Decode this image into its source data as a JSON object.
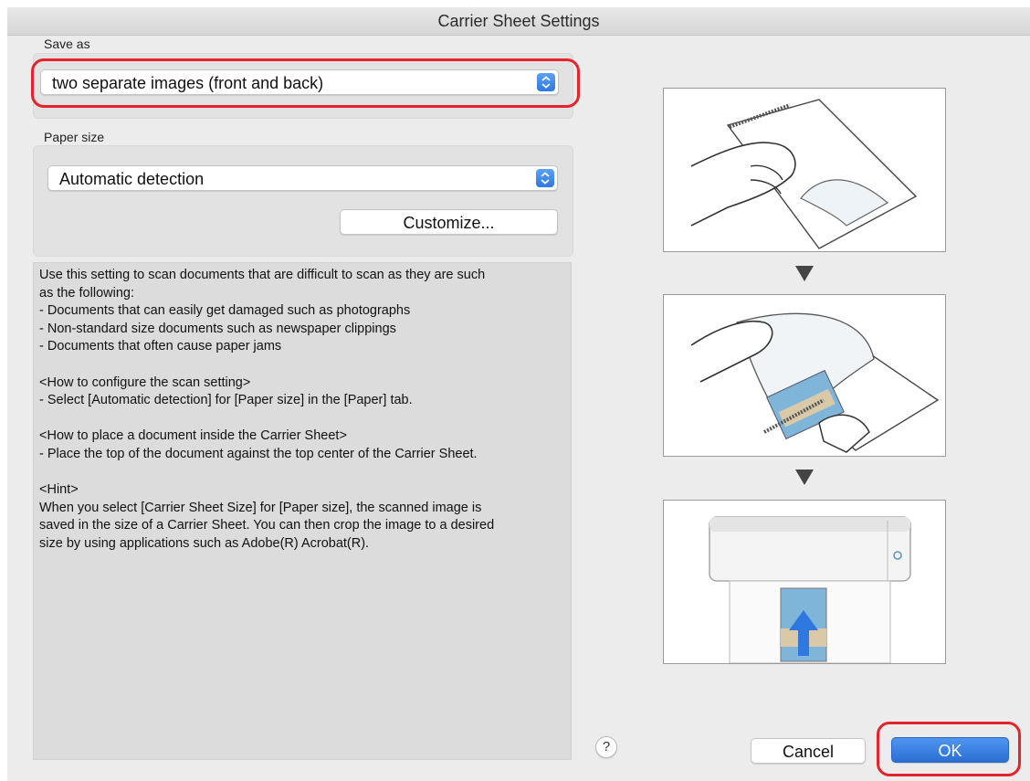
{
  "window": {
    "title": "Carrier Sheet Settings"
  },
  "save_as": {
    "label": "Save as",
    "selected": "two separate images (front and back)"
  },
  "paper_size": {
    "label": "Paper size",
    "selected": "Automatic detection",
    "customize_label": "Customize..."
  },
  "description": {
    "lines": [
      "Use this setting to scan documents that are difficult to scan as they are such",
      "as the following:",
      "- Documents that can easily get damaged such as photographs",
      "- Non-standard size documents such as newspaper clippings",
      "- Documents that often cause paper jams",
      "",
      "<How to configure the scan setting>",
      "- Select [Automatic detection] for [Paper size] in the [Paper] tab.",
      "",
      "<How to place a document inside the Carrier Sheet>",
      "- Place the top of the document against the top center of the Carrier Sheet.",
      "",
      "<Hint>",
      "When you select [Carrier Sheet Size] for [Paper size], the scanned image is",
      "saved in the size of a Carrier Sheet. You can then crop the image to a desired",
      "size by using applications such as Adobe(R) Acrobat(R)."
    ]
  },
  "help_label": "?",
  "buttons": {
    "cancel": "Cancel",
    "ok": "OK"
  },
  "colors": {
    "highlight": "#e3242b",
    "accent": "#2f78e0"
  }
}
